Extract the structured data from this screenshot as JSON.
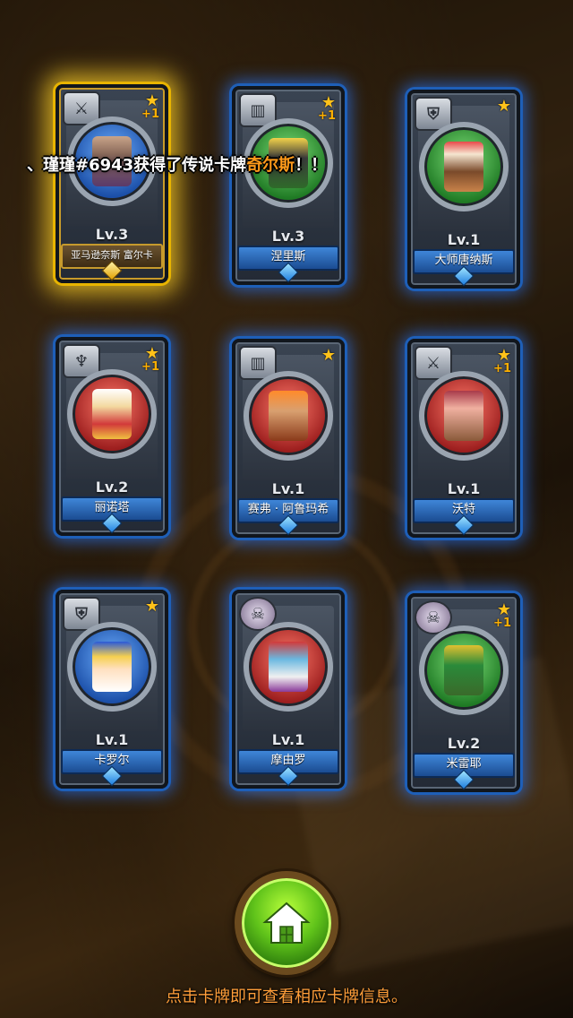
{
  "announcement": {
    "prefix": "、瑾瑾#6943获得了传说卡牌",
    "highlight": "奇尔斯",
    "suffix": "！！"
  },
  "cards": [
    {
      "name": "亚马逊奈斯 富尔卡",
      "level": "Lv.3",
      "plus": "+1",
      "class_icon": "crossed-swords-icon",
      "legend": true
    },
    {
      "name": "涅里斯",
      "level": "Lv.3",
      "plus": "+1",
      "class_icon": "book-icon",
      "legend": false
    },
    {
      "name": "大师唐纳斯",
      "level": "Lv.1",
      "plus": "",
      "class_icon": "sword-shield-icon",
      "legend": false
    },
    {
      "name": "丽诺塔",
      "level": "Lv.2",
      "plus": "+1",
      "class_icon": "wings-icon",
      "legend": false
    },
    {
      "name": "赛弗 · 阿鲁玛希",
      "level": "Lv.1",
      "plus": "",
      "class_icon": "book-icon",
      "legend": false
    },
    {
      "name": "沃特",
      "level": "Lv.1",
      "plus": "+1",
      "class_icon": "crossed-swords-icon",
      "legend": false
    },
    {
      "name": "卡罗尔",
      "level": "Lv.1",
      "plus": "",
      "class_icon": "sword-shield-icon",
      "legend": false
    },
    {
      "name": "摩由罗",
      "level": "Lv.1",
      "plus": "",
      "class_icon": "skull-icon",
      "legend": false
    },
    {
      "name": "米雷耶",
      "level": "Lv.2",
      "plus": "+1",
      "class_icon": "skull-icon",
      "legend": false
    }
  ],
  "footer_tip": "点击卡牌即可查看相应卡牌信息。",
  "colors": {
    "announce_highlight": "#ff9a1a",
    "footer_tip": "#ff9e3a",
    "card_glow": "#1e5fb8",
    "legend_glow": "#e8b400"
  }
}
